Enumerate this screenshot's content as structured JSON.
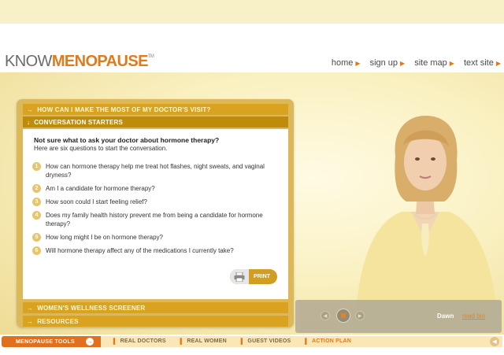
{
  "header": {
    "logo": {
      "part1": "KNOW",
      "part2": "MENOPAUSE",
      "tm": "TM"
    },
    "nav": [
      {
        "label": "home",
        "icon": "triangle-right-icon"
      },
      {
        "label": "sign up",
        "icon": "triangle-right-icon"
      },
      {
        "label": "site map",
        "icon": "triangle-right-icon"
      },
      {
        "label": "text site",
        "icon": "triangle-right-icon"
      }
    ]
  },
  "panel": {
    "sections": [
      {
        "label": "HOW CAN I MAKE THE MOST OF MY DOCTOR'S VISIT?",
        "state": "collapsed"
      },
      {
        "label": "CONVERSATION STARTERS",
        "state": "open"
      },
      {
        "label": "WOMEN'S WELLNESS SCREENER",
        "state": "collapsed"
      },
      {
        "label": "RESOURCES",
        "state": "collapsed"
      }
    ],
    "heading": "Not sure what to ask your doctor about hormone therapy?",
    "subheading": "Here are six questions to start the conversation.",
    "questions": [
      {
        "num": "1",
        "text": "How can hormone therapy help me treat hot flashes, night sweats, and vaginal dryness?"
      },
      {
        "num": "2",
        "text": "Am I a candidate for hormone therapy?"
      },
      {
        "num": "3",
        "text": "How soon could I start feeling relief?"
      },
      {
        "num": "4",
        "text": "Does my family health history prevent me from being a candidate for hormone therapy?"
      },
      {
        "num": "5",
        "text": "How long might I be on hormone therapy?"
      },
      {
        "num": "6",
        "text": "Will hormone therapy affect any of the medications I currently take?"
      }
    ],
    "print_label": "PRINT"
  },
  "video": {
    "presenter": "Dawn",
    "bio_link": "read bio"
  },
  "bottom": {
    "tools_label": "MENOPAUSE TOOLS",
    "items": [
      {
        "label": "REAL DOCTORS"
      },
      {
        "label": "REAL WOMEN"
      },
      {
        "label": "GUEST VIDEOS"
      },
      {
        "label": "ACTION PLAN"
      }
    ]
  },
  "colors": {
    "accent": "#e07b1c",
    "gold": "#d9a21f",
    "gold_dark": "#be8c0a",
    "stage": "#faf1c2"
  }
}
